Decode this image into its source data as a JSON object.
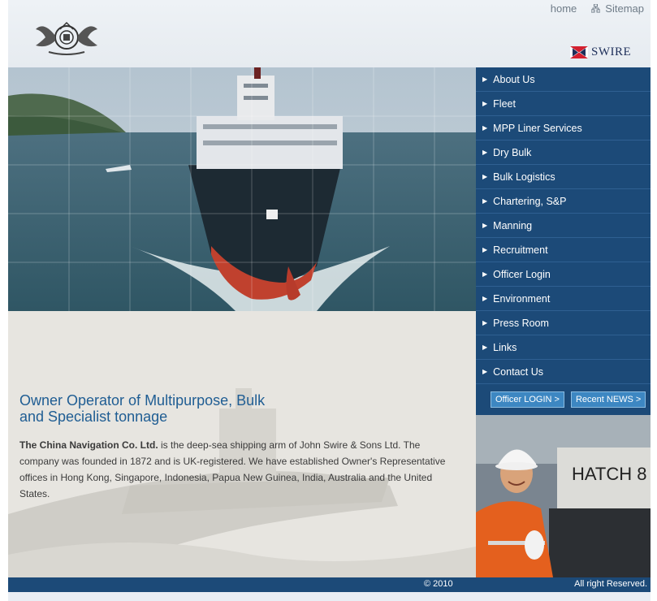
{
  "header": {
    "links": {
      "home": "home",
      "sitemap": "Sitemap"
    },
    "brand": "SWIRE"
  },
  "nav": {
    "items": [
      {
        "label": "About Us"
      },
      {
        "label": "Fleet"
      },
      {
        "label": "MPP Liner Services"
      },
      {
        "label": "Dry Bulk"
      },
      {
        "label": "Bulk Logistics"
      },
      {
        "label": "Chartering, S&P"
      },
      {
        "label": "Manning"
      },
      {
        "label": "Recruitment"
      },
      {
        "label": "Officer Login"
      },
      {
        "label": "Environment"
      },
      {
        "label": "Press Room"
      },
      {
        "label": "Links"
      },
      {
        "label": "Contact Us"
      }
    ]
  },
  "buttons": {
    "officer_login": "Officer LOGIN >",
    "recent_news": "Recent NEWS >"
  },
  "main": {
    "heading_line1": "Owner Operator of Multipurpose, Bulk",
    "heading_line2": "and Specialist tonnage",
    "company_name": "The China Navigation Co. Ltd.",
    "description": " is the deep-sea shipping arm of John Swire & Sons Ltd. The company was founded in 1872 and is UK-registered. We have established Owner's Representative offices in Hong Kong, Singapore, Indonesia, Papua New Guinea, India, Australia and the United States."
  },
  "photo_text": {
    "hatch": "HATCH 8"
  },
  "footer": {
    "copyright": "© 2010",
    "rights": "All right Reserved."
  },
  "colors": {
    "nav_bg": "#1c4a78",
    "heading": "#1f5d93",
    "button": "#3d87c2"
  }
}
